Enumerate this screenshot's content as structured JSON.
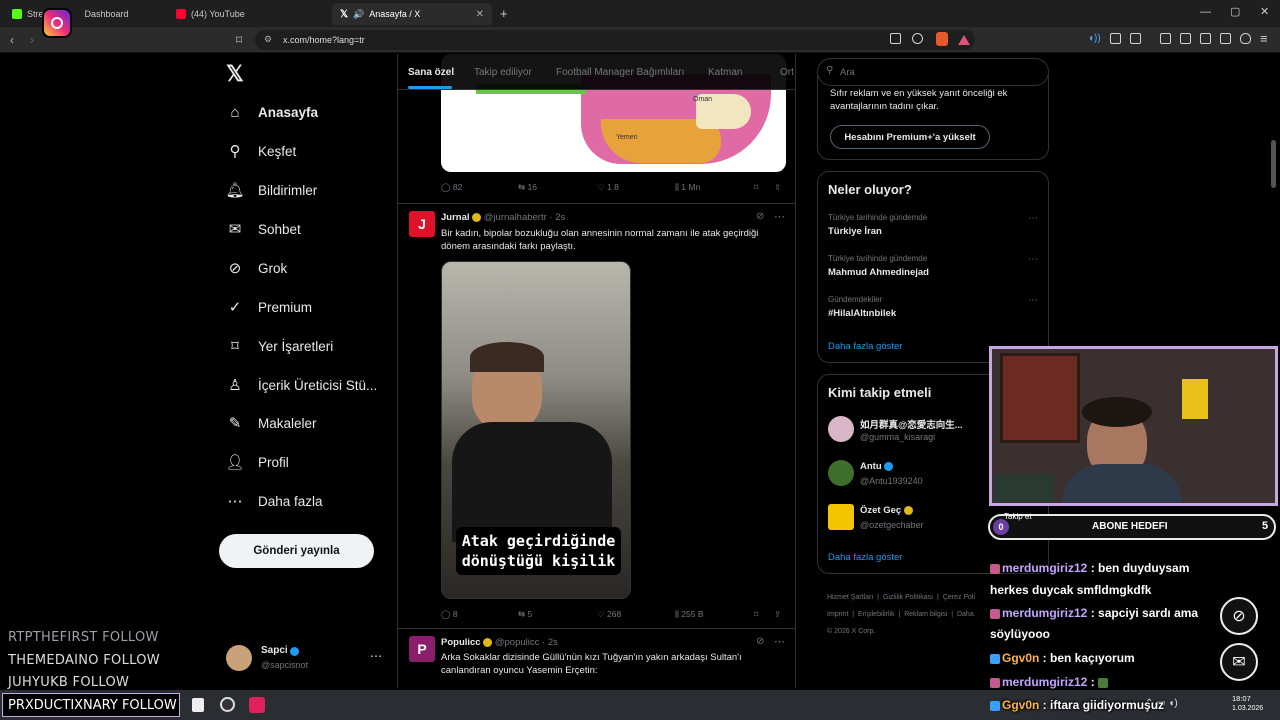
{
  "browser": {
    "tabs": [
      {
        "label": "Stre",
        "label2": "Dashboard"
      },
      {
        "label": "(44) YouTube"
      },
      {
        "label": "Anasayfa / X"
      }
    ],
    "url": "x.com/home?lang=tr"
  },
  "nav": {
    "items": [
      {
        "label": "Anasayfa",
        "icon": "home-icon"
      },
      {
        "label": "Keşfet",
        "icon": "search-icon"
      },
      {
        "label": "Bildirimler",
        "icon": "bell-icon"
      },
      {
        "label": "Sohbet",
        "icon": "mail-icon"
      },
      {
        "label": "Grok",
        "icon": "grok-icon"
      },
      {
        "label": "Premium",
        "icon": "premium-icon"
      },
      {
        "label": "Yer İşaretleri",
        "icon": "bookmark-icon"
      },
      {
        "label": "İçerik Üreticisi Stü...",
        "icon": "creator-icon"
      },
      {
        "label": "Makaleler",
        "icon": "article-icon"
      },
      {
        "label": "Profil",
        "icon": "profile-icon"
      },
      {
        "label": "Daha fazla",
        "icon": "more-icon"
      }
    ],
    "post_button": "Gönderi yayınla",
    "account": {
      "name": "Sapci",
      "handle": "@sapcisnot"
    }
  },
  "feed": {
    "tabs": [
      "Sana özel",
      "Takip ediliyor",
      "Football Manager Bağımlıları",
      "Katman",
      "Ort"
    ],
    "map_labels": [
      "Oman",
      "Yemen"
    ],
    "tweets": [
      {
        "stats": {
          "replies": "82",
          "reposts": "16",
          "likes": "1 8",
          "views": "1 Mn"
        }
      },
      {
        "avatar": "J",
        "name": "Jurnal",
        "handle": "@jurnalhabertr",
        "time": "· 2s",
        "text": "Bir kadın, bipolar bozukluğu olan annesinin normal zamanı ile atak geçirdiği dönem arasındaki farkı paylaştı.",
        "media_caption": "Atak geçirdiğinde dönüştüğü kişilik",
        "stats": {
          "replies": "8",
          "reposts": "5",
          "likes": "268",
          "views": "255 B"
        }
      },
      {
        "avatar": "P",
        "name": "Populicc",
        "handle": "@populicc",
        "time": "· 2s",
        "text": "Arka Sokaklar dizisinde Güllü'nün kızı Tuğyan'ın yakın arkadaşı Sultan'ı canlandıran oyuncu Yasemin Erçetin:"
      }
    ]
  },
  "right": {
    "search_placeholder": "Ara",
    "premium": {
      "text": "Sıfır reklam ve en yüksek yanıt önceliği ek avantajlarının tadını çıkar.",
      "button": "Hesabını Premium+'a yükselt"
    },
    "trends": {
      "title": "Neler oluyor?",
      "items": [
        {
          "meta": "Türkiye tarihinde gündemde",
          "name": "Türkiye İran"
        },
        {
          "meta": "Türkiye tarihinde gündemde",
          "name": "Mahmud Ahmedinejad"
        },
        {
          "meta": "Gündemdekiler",
          "name": "#HilalAltınbilek"
        }
      ],
      "more": "Daha fazla göster"
    },
    "who": {
      "title": "Kimi takip etmeli",
      "items": [
        {
          "name": "如月群真@恋愛志向生...",
          "handle": "@gumma_kisaragi"
        },
        {
          "name": "Antu",
          "handle": "@Antu1939240"
        },
        {
          "name": "Özet Geç",
          "handle": "@ozetgechaber"
        }
      ],
      "follow_partial": "Takip et",
      "more": "Daha fazla göster"
    },
    "footer": {
      "row1": [
        "Hizmet Şartları",
        "Gizlilik Politikası",
        "Çerez Poli"
      ],
      "row2": [
        "Imprint",
        "Erişilebilirlik",
        "Reklam bilgisi",
        "Daha"
      ],
      "copyright": "© 2026 X Corp."
    }
  },
  "stream": {
    "followers": [
      "RTPTHEFIRST  FOLLOW",
      "THEMEDAINO  FOLLOW",
      "JUHYUKB  FOLLOW",
      "PRXDUCTIXNARY  FOLLOW"
    ],
    "sub_goal": {
      "label": "ABONE HEDEFI",
      "current": "0",
      "target": "5"
    },
    "chat": [
      {
        "user": "merdumgiriz12",
        "msg": "ben duyduysam",
        "cont": "herkes duycak smfldmgkdfk"
      },
      {
        "user": "merdumgiriz12",
        "msg": "sapciyi sardı ama",
        "cont": "söylüyooo"
      },
      {
        "user": "Ggv0n",
        "msg": "ben kaçıyorum"
      },
      {
        "user": "merdumgiriz12",
        "msg": ""
      },
      {
        "user": "Ggv0n",
        "msg": "iftara giidiyormuşuz"
      }
    ]
  },
  "taskbar": {
    "time": "18:07",
    "date": "1.03.2026"
  }
}
